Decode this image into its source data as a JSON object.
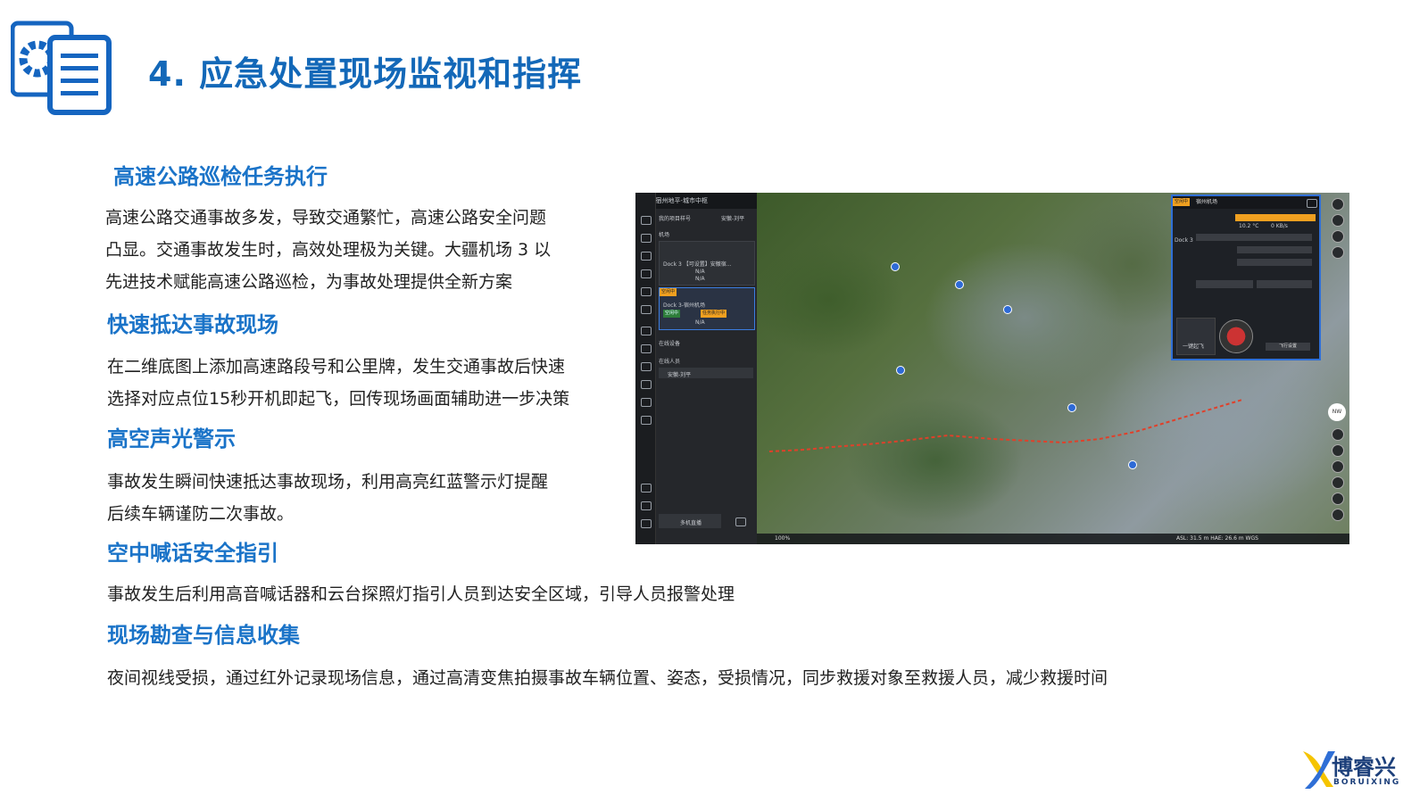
{
  "header": {
    "title": "4. 应急处置现场监视和指挥",
    "icon": "document-gear-icon"
  },
  "sections": [
    {
      "heading": "高速公路巡检任务执行",
      "lines": [
        "高速公路交通事故多发，导致交通繁忙，高速公路安全问题",
        "凸显。交通事故发生时，高效处理极为关键。大疆机场 3 以",
        "先进技术赋能高速公路巡检，为事故处理提供全新方案"
      ]
    },
    {
      "heading": "快速抵达事故现场",
      "lines": [
        "在二维底图上添加高速路段号和公里牌，发生交通事故后快速",
        "选择对应点位15秒开机即起飞，回传现场画面辅助进一步决策"
      ]
    },
    {
      "heading": "高空声光警示",
      "lines": [
        "事故发生瞬间快速抵达事故现场，利用高亮红蓝警示灯提醒",
        "后续车辆谨防二次事故。"
      ]
    },
    {
      "heading": "空中喊话安全指引",
      "lines": [
        "事故发生后利用高音喊话器和云台探照灯指引人员到达安全区域，引导人员报警处理"
      ]
    },
    {
      "heading": "现场勘查与信息收集",
      "lines": [
        "夜间视线受损，通过红外记录现场信息，通过高清变焦拍摄事故车辆位置、姿态，受损情况，同步救援对象至救援人员，减少救援时间"
      ]
    }
  ],
  "screenshot": {
    "panel_header": "安徽-宿州地平-城市中枢",
    "project_label": "我的项目样号",
    "project_user": "安徽-刘平",
    "section_dock": "机场",
    "dock1_label": "Dock 3 【可设置】安徽宿...",
    "dock2_label": "Dock 3-宿州机场",
    "status_na": "N/A",
    "tag_online": "空闲中",
    "tag_alarm": "任务执行中",
    "section_devices": "在线设备",
    "section_members": "在线人员",
    "member_name": "安徽-刘平",
    "bottom_button": "多机直播",
    "map_scale": "100%",
    "map_status": "ASL: 31.5 m    HAE: 26.6 m    WGS",
    "drone_panel_title": "宿州机场",
    "drone_dock": "Dock 3",
    "drone_temp": "10.2 °C",
    "drone_wind": "0 KB/s",
    "drone_takeoff": "一键起飞",
    "drone_flight_setting": "飞行设置",
    "compass_label": "NW",
    "compass_deg": "295"
  },
  "brand": {
    "name": "博睿兴",
    "latin": "BORUIXING"
  },
  "colors": {
    "title_blue": "#1368b8",
    "heading_blue": "#1a73c8",
    "brand_blue": "#1c3f7a",
    "accent_orange": "#f0a020",
    "accent_yellow": "#f5c400"
  }
}
